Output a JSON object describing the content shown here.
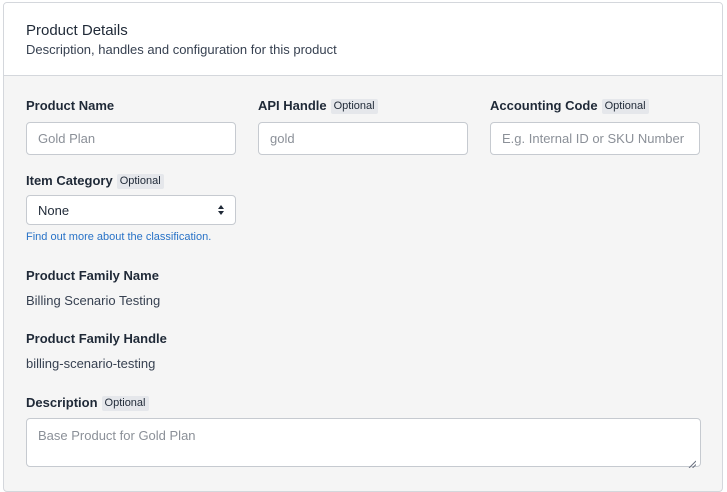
{
  "header": {
    "title": "Product Details",
    "subtitle": "Description, handles and configuration for this product"
  },
  "product_name": {
    "label": "Product Name",
    "value": "",
    "placeholder": "Gold Plan"
  },
  "api_handle": {
    "label": "API Handle",
    "badge": "Optional",
    "value": "",
    "placeholder": "gold"
  },
  "accounting_code": {
    "label": "Accounting Code",
    "badge": "Optional",
    "value": "",
    "placeholder": "E.g. Internal ID or SKU Number"
  },
  "item_category": {
    "label": "Item Category",
    "badge": "Optional",
    "selected": "None",
    "help_link": "Find out more about the classification."
  },
  "product_family_name": {
    "label": "Product Family Name",
    "value": "Billing Scenario Testing"
  },
  "product_family_handle": {
    "label": "Product Family Handle",
    "value": "billing-scenario-testing"
  },
  "description": {
    "label": "Description",
    "badge": "Optional",
    "value": "",
    "placeholder": "Base Product for Gold Plan"
  },
  "colors": {
    "link": "#2872c7",
    "panel_bg": "#f5f5f5",
    "border": "#d4d7dc"
  },
  "icons": {
    "select": "updown-chevron-icon",
    "textarea": "resize-grip-icon"
  }
}
